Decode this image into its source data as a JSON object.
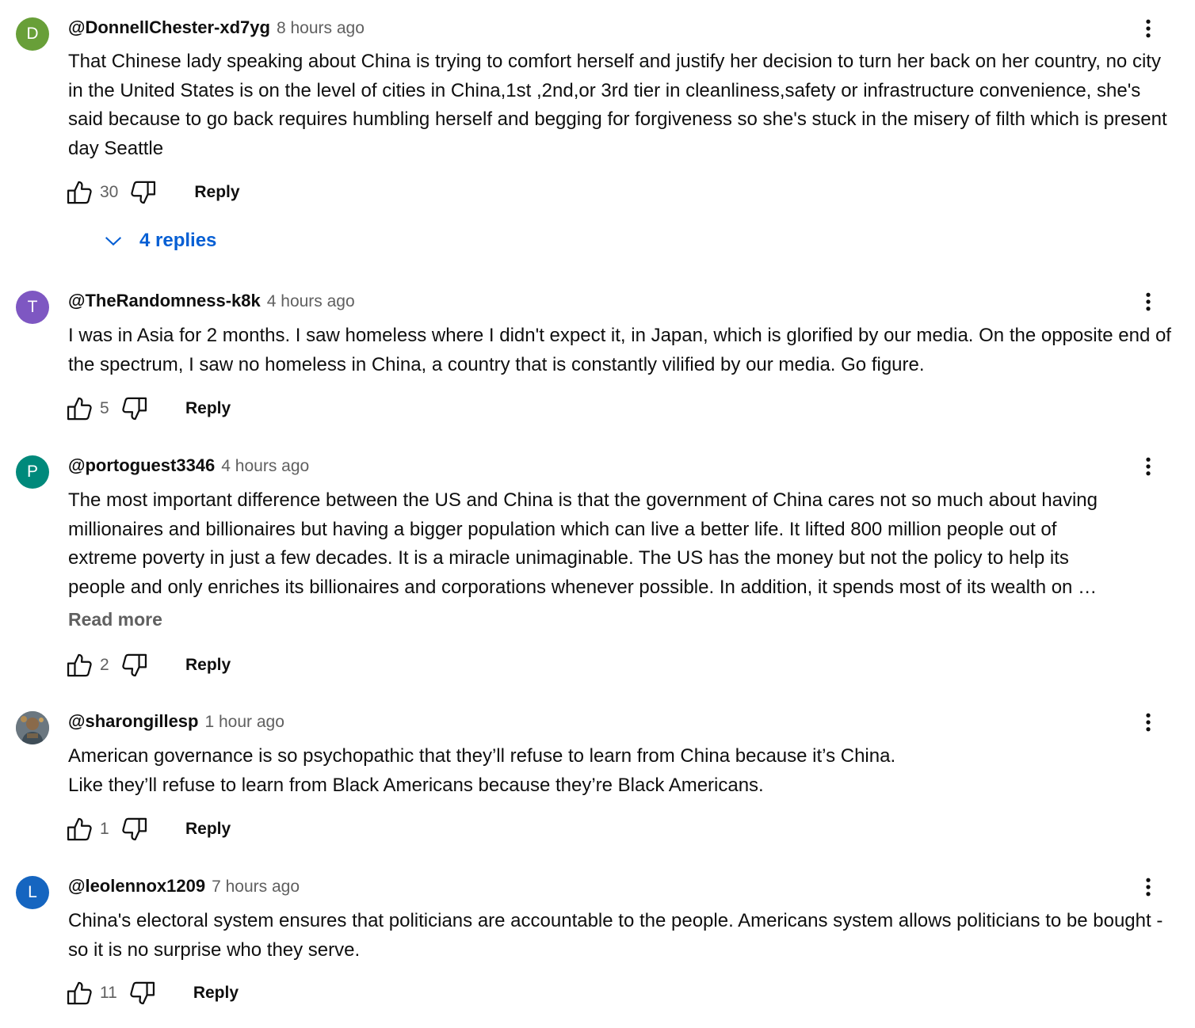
{
  "comments": [
    {
      "avatar_letter": "D",
      "avatar_color": "#689f38",
      "author": "@DonnellChester-xd7yg",
      "time": "8 hours ago",
      "text": "That Chinese lady speaking about China is trying to comfort herself and justify her decision to turn her back on her country, no city in the United States is on the level of cities in China,1st ,2nd,or 3rd tier in cleanliness,safety or infrastructure convenience, she's said because to go back requires humbling herself and begging for forgiveness so she's stuck in the misery of filth which is present day Seattle",
      "likes": "30",
      "reply_label": "Reply",
      "replies_label": "4 replies"
    },
    {
      "avatar_letter": "T",
      "avatar_color": "#7e57c2",
      "author": "@TheRandomness-k8k",
      "time": "4 hours ago",
      "text": "I was in Asia for 2 months. I saw homeless where I didn't expect it, in Japan, which is glorified by our media. On the opposite end of the spectrum, I saw no homeless in China, a country that is constantly vilified by our media. Go figure.",
      "likes": "5",
      "reply_label": "Reply"
    },
    {
      "avatar_letter": "P",
      "avatar_color": "#00897b",
      "author": "@portoguest3346",
      "time": "4 hours ago",
      "text_lines": [
        "The most important difference between the US and China is that the government of China cares not so much about having",
        "millionaires and billionaires but having a bigger population which can live a better life. It lifted 800 million people out of",
        "extreme poverty in just a few decades. It is a miracle unimaginable. The US has the money but not the policy to help its",
        "people and only enriches its billionaires and corporations whenever possible. In addition, it spends most of its wealth on …"
      ],
      "read_more_label": "Read more",
      "likes": "2",
      "reply_label": "Reply"
    },
    {
      "avatar_letter": "",
      "avatar_color": "#5d6b72",
      "author": "@sharongillesp",
      "time": "1 hour ago",
      "text": "American governance is so psychopathic that they’ll refuse to learn from China because it’s China.\nLike they’ll refuse to learn from Black Americans because they’re Black Americans.",
      "likes": "1",
      "reply_label": "Reply"
    },
    {
      "avatar_letter": "L",
      "avatar_color": "#1565c0",
      "author": "@leolennox1209",
      "time": "7 hours ago",
      "text": "China's electoral system ensures that politicians are accountable to the people. Americans system allows politicians to be bought - so it is no surprise who they serve.",
      "likes": "11",
      "reply_label": "Reply"
    }
  ]
}
